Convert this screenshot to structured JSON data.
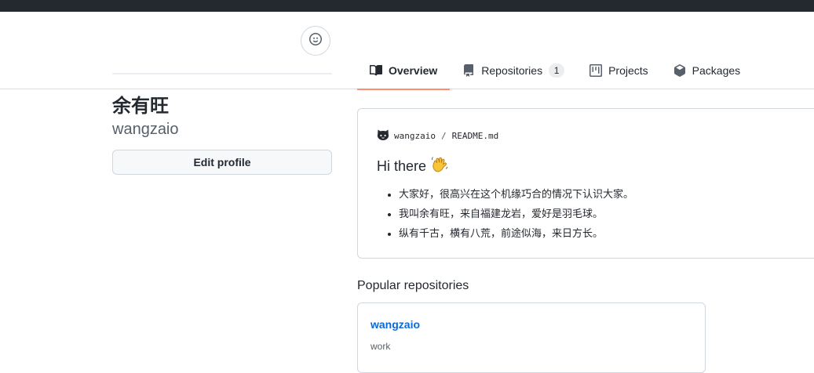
{
  "nav": {
    "tabs": [
      {
        "label": "Overview",
        "icon": "book-icon",
        "selected": true
      },
      {
        "label": "Repositories",
        "icon": "repo-icon",
        "count": "1"
      },
      {
        "label": "Projects",
        "icon": "project-icon"
      },
      {
        "label": "Packages",
        "icon": "package-icon"
      }
    ]
  },
  "profile": {
    "name": "余有旺",
    "login": "wangzaio",
    "edit_label": "Edit profile",
    "status_icon": "smiley-icon"
  },
  "readme": {
    "owner": "wangzaio",
    "separator": "/",
    "file": "README.md",
    "heading": "Hi there",
    "heading_emoji": "waving-hand-icon",
    "items": [
      "大家好，很高兴在这个机缘巧合的情况下认识大家。",
      "我叫余有旺，来自福建龙岩，爱好是羽毛球。",
      "纵有千古，横有八荒，前途似海，来日方长。"
    ]
  },
  "popular": {
    "title": "Popular repositories",
    "repos": [
      {
        "name": "wangzaio",
        "description": "work"
      }
    ]
  },
  "colors": {
    "topbar": "#24292f",
    "tab_underline": "#fd8c73",
    "link": "#0969da",
    "border": "#d0d7de"
  }
}
